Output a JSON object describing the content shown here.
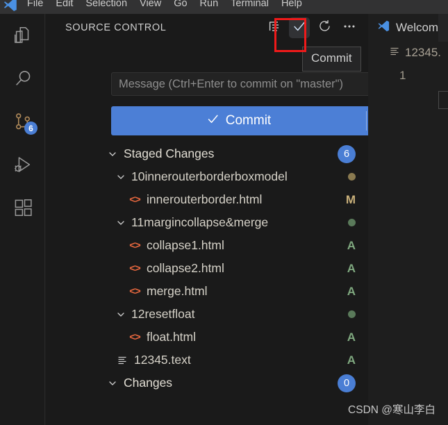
{
  "window": {
    "menu_items": [
      "File",
      "Edit",
      "Selection",
      "View",
      "Go",
      "Run",
      "Terminal",
      "Help"
    ],
    "logo_icon": "vscode-logo-icon"
  },
  "activity_bar": {
    "items": [
      {
        "name": "explorer",
        "icon": "files-icon",
        "badge": ""
      },
      {
        "name": "search",
        "icon": "search-icon",
        "badge": ""
      },
      {
        "name": "source-control",
        "icon": "source-control-icon",
        "badge": "6"
      },
      {
        "name": "run-debug",
        "icon": "run-and-debug-icon",
        "badge": ""
      },
      {
        "name": "extensions",
        "icon": "extensions-icon",
        "badge": ""
      }
    ]
  },
  "source_control": {
    "title": "SOURCE CONTROL",
    "actions": [
      {
        "name": "view-as-tree",
        "icon": "list-tree-icon",
        "tooltip": ""
      },
      {
        "name": "commit",
        "icon": "check-icon",
        "tooltip": "Commit"
      },
      {
        "name": "refresh",
        "icon": "refresh-icon",
        "tooltip": ""
      },
      {
        "name": "more-actions",
        "icon": "ellipsis-icon",
        "tooltip": ""
      }
    ],
    "tooltip_text": "Commit",
    "message_placeholder": "Message (Ctrl+Enter to commit on \"master\")",
    "message_value": "",
    "commit_button": {
      "label": "Commit",
      "icon": "check-icon",
      "dropdown_icon": "chevron-down-icon",
      "color": "#4c7fd6"
    },
    "groups": [
      {
        "name": "staged-changes",
        "label": "Staged Changes",
        "badge": "6",
        "badge_color": "#4a7ed4",
        "expanded": true,
        "children": [
          {
            "type": "folder",
            "label": "10innerouterborderboxmodel",
            "dot_color": "#8a7a50",
            "expanded": true,
            "children": [
              {
                "type": "file",
                "label": "innerouterborder.html",
                "icon": "html-file-icon",
                "status": "M",
                "status_color": "#c9b07a"
              }
            ]
          },
          {
            "type": "folder",
            "label": "11margincollapse&merge",
            "dot_color": "#5a7a5a",
            "expanded": true,
            "children": [
              {
                "type": "file",
                "label": "collapse1.html",
                "icon": "html-file-icon",
                "status": "A",
                "status_color": "#7fa87f"
              },
              {
                "type": "file",
                "label": "collapse2.html",
                "icon": "html-file-icon",
                "status": "A",
                "status_color": "#7fa87f"
              },
              {
                "type": "file",
                "label": "merge.html",
                "icon": "html-file-icon",
                "status": "A",
                "status_color": "#7fa87f"
              }
            ]
          },
          {
            "type": "folder",
            "label": "12resetfloat",
            "dot_color": "#5a7a5a",
            "expanded": true,
            "children": [
              {
                "type": "file",
                "label": "float.html",
                "icon": "html-file-icon",
                "status": "A",
                "status_color": "#7fa87f"
              }
            ]
          },
          {
            "type": "file",
            "label": "12345.text",
            "icon": "text-file-icon",
            "status": "A",
            "status_color": "#7fa87f",
            "top_level": true
          }
        ]
      },
      {
        "name": "changes",
        "label": "Changes",
        "badge": "0",
        "badge_color": "#4a7ed4",
        "expanded": true,
        "children": []
      }
    ]
  },
  "editor": {
    "tab_label": "Welcom",
    "tab_icon": "vscode-logo-icon",
    "breadcrumb_label": "12345.",
    "breadcrumb_icon": "text-file-icon",
    "line_number": "1"
  },
  "watermark": "CSDN @寒山李白"
}
